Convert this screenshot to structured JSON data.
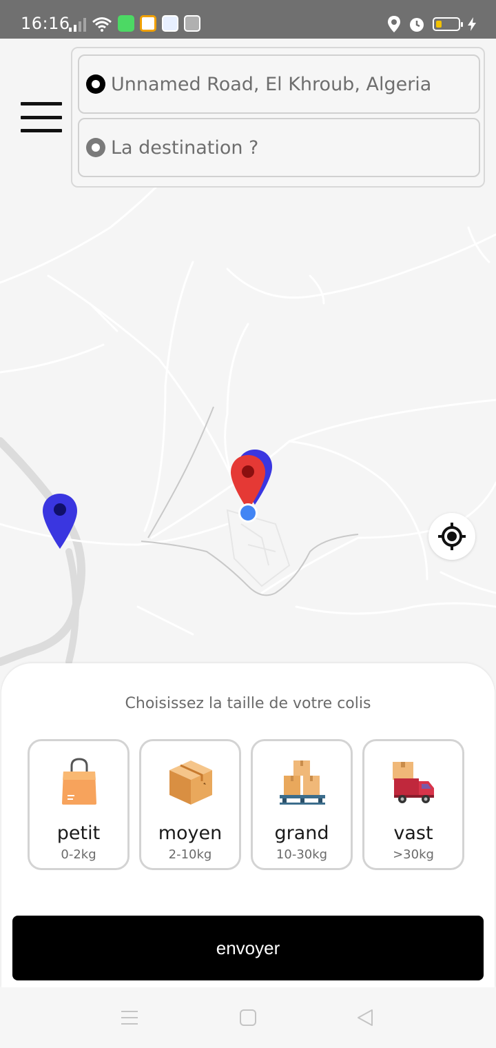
{
  "status_bar": {
    "time": "16:16",
    "icons": [
      "signal-icon",
      "wifi-icon",
      "chat-app-icon",
      "app-icon",
      "calendar-app-icon",
      "layers-app-icon",
      "location-icon",
      "alarm-icon",
      "battery-icon",
      "charging-icon"
    ]
  },
  "search": {
    "origin": "Unnamed Road, El Khroub, Algeria",
    "destination_placeholder": "La destination ?"
  },
  "map": {
    "markers": [
      "blue-map-marker",
      "red-map-marker",
      "current-location-dot"
    ]
  },
  "sheet": {
    "title": "Choisissez la taille de votre colis",
    "sizes": [
      {
        "name": "petit",
        "weight": "0-2kg",
        "icon": "shopping-bag-icon"
      },
      {
        "name": "moyen",
        "weight": "2-10kg",
        "icon": "box-icon"
      },
      {
        "name": "grand",
        "weight": "10-30kg",
        "icon": "pallet-boxes-icon"
      },
      {
        "name": "vast",
        "weight": ">30kg",
        "icon": "truck-icon"
      }
    ],
    "send_label": "envoyer"
  },
  "colors": {
    "status_bar": "#707070",
    "primary_button": "#000000",
    "marker_blue": "#3a36e0",
    "marker_red": "#e53935"
  }
}
